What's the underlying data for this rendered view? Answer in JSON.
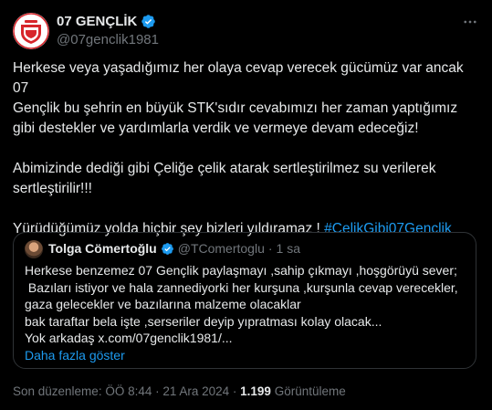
{
  "author": {
    "name": "07 GENÇLİK",
    "handle": "@07genclik1981",
    "verified": true
  },
  "tweet": {
    "paragraphs": [
      [
        "Herkese veya yaşadığımız her olaya cevap verecek gücümüz var ancak 07",
        "Gençlik bu şehrin en büyük STK'sıdır cevabımızı her zaman yaptığımız",
        "gibi destekler ve yardımlarla verdik ve vermeye devam edeceğiz!"
      ],
      [
        "Abimizinde dediği gibi Çeliğe çelik  atarak sertleştirilmez su verilerek",
        "sertleştirilir!!!"
      ]
    ],
    "last_line": "Yürüdüğümüz yolda hiçbir şey bizleri yıldıramaz ! ",
    "hashtag": "#CelikGibi07Genclik"
  },
  "quote": {
    "name": "Tolga Cömertoğlu",
    "handle": "@TComertoglu",
    "separator": "·",
    "time": "1 sa",
    "lines": [
      "Herkese benzemez 07 Gençlik paylaşmayı ,sahip çıkmayı ,hoşgörüyü sever;",
      " Bazıları istiyor ve hala zannediyorki her kurşuna ,kurşunla cevap verecekler,",
      "gaza gelecekler ve bazılarına malzeme olacaklar",
      "bak taraftar bela işte ,serseriler deyip yıpratması kolay olacak...",
      "Yok arkadaş x.com/07genclik1981/..."
    ],
    "show_more": "Daha fazla göster"
  },
  "footer": {
    "edited": "Son düzenleme: ÖÖ 8:44 · 21 Ara 2024 · ",
    "views_count": "1.199",
    "views_label": " Görüntüleme"
  },
  "colors": {
    "background": "#000000",
    "text": "#e7e9ea",
    "secondary": "#71767b",
    "accent": "#1d9bf0",
    "border": "#2f3336",
    "logo_red": "#d7262b"
  },
  "icons": {
    "verified": "verified-badge-icon",
    "more": "more-options-icon"
  }
}
